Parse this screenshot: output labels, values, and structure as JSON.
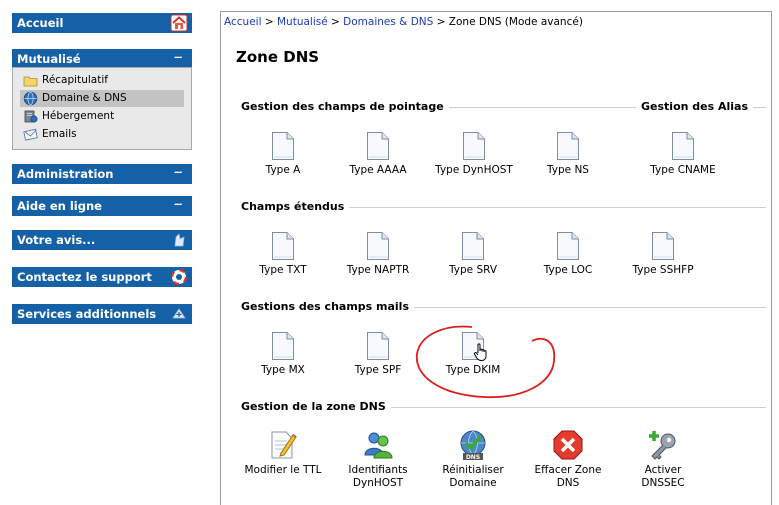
{
  "sidebar": {
    "home": "Accueil",
    "mutualise": "Mutualisé",
    "items": [
      {
        "label": "Récapitulatif"
      },
      {
        "label": "Domaine & DNS"
      },
      {
        "label": "Hébergement"
      },
      {
        "label": "Emails"
      }
    ],
    "administration": "Administration",
    "aide": "Aide en ligne",
    "avis": "Votre avis...",
    "support": "Contactez le support",
    "services": "Services additionnels",
    "collapse_glyph": "−"
  },
  "breadcrumb": {
    "home": "Accueil",
    "sep": " > ",
    "mutualise": "Mutualisé",
    "domaines": "Domaines & DNS",
    "current": "Zone DNS (Mode avancé)"
  },
  "title": "Zone DNS",
  "sections": {
    "pointage": "Gestion des champs de pointage",
    "alias": "Gestion des Alias",
    "etendus": "Champs étendus",
    "mails": "Gestions des champs mails",
    "zone": "Gestion de la zone DNS"
  },
  "pointage": [
    "Type A",
    "Type AAAA",
    "Type DynHOST",
    "Type NS"
  ],
  "alias": [
    "Type CNAME"
  ],
  "etendus": [
    "Type TXT",
    "Type NAPTR",
    "Type SRV",
    "Type LOC",
    "Type SSHFP"
  ],
  "mails": [
    "Type MX",
    "Type SPF",
    "Type DKIM"
  ],
  "zone": [
    {
      "l1": "Modifier le TTL",
      "l2": ""
    },
    {
      "l1": "Identifiants",
      "l2": "DynHOST"
    },
    {
      "l1": "Réinitialiser",
      "l2": "Domaine"
    },
    {
      "l1": "Effacer Zone",
      "l2": "DNS"
    },
    {
      "l1": "Activer",
      "l2": "DNSSEC"
    }
  ],
  "dns_badge": "DNS",
  "colors": {
    "sidebar_blue": "#1561a8",
    "link": "#1a3ab5",
    "annotation_red": "#e01b1b"
  }
}
